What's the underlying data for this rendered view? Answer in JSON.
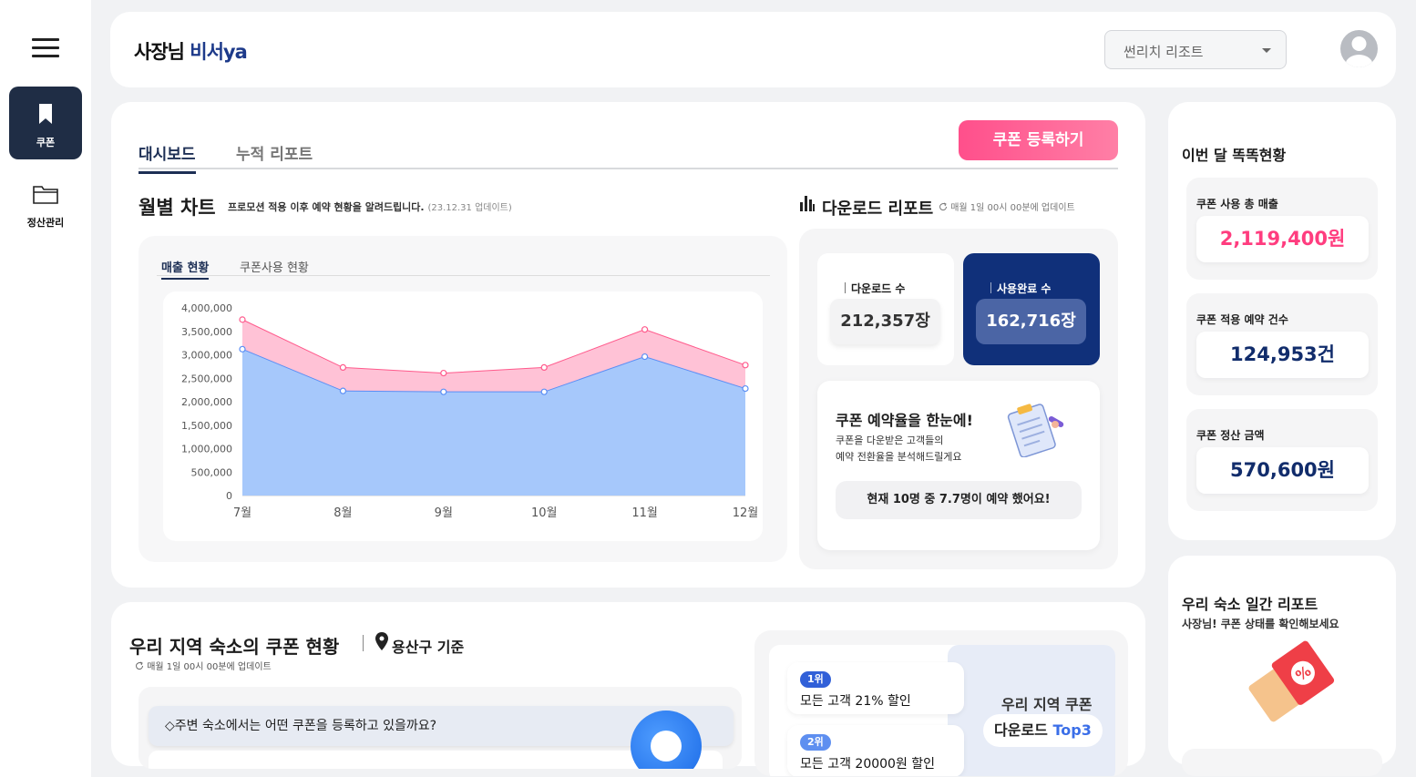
{
  "sidebar": {
    "items": [
      {
        "label": "쿠폰",
        "icon": "bookmark-icon",
        "active": true
      },
      {
        "label": "정산관리",
        "icon": "folder-icon",
        "active": false
      }
    ]
  },
  "header": {
    "logo_dark": "사장님 ",
    "logo_blue": "비서ya",
    "resort_select": "썬리치 리조트"
  },
  "dashboard": {
    "tabs": [
      {
        "label": "대시보드",
        "active": true
      },
      {
        "label": "누적 리포트",
        "active": false
      }
    ],
    "coupon_register_label": "쿠폰 등록하기",
    "monthly": {
      "title": "월별 차트",
      "desc": "프로모션 적용 이후 예약 현황을 알려드립니다.",
      "updated": "(23.12.31 업데이트)",
      "tabs": [
        {
          "label": "매출 현황",
          "active": true
        },
        {
          "label": "쿠폰사용 현황",
          "active": false
        }
      ]
    },
    "download_report": {
      "title": "다운로드 리포트",
      "updated": "매월 1일 00시 00분에 업데이트",
      "download_label": "다운로드 수",
      "download_value": "212,357장",
      "used_label": "사용완료 수",
      "used_value": "162,716장",
      "rate_title": "쿠폰 예약율을 한눈에!",
      "rate_desc_1": "쿠폰을 다운받은 고객들의",
      "rate_desc_2": "예약 전환율을 분석해드릴게요",
      "rate_pill": "현재 10명 중 7.7명이 예약 했어요!"
    }
  },
  "chart_data": {
    "type": "area",
    "categories": [
      "7월",
      "8월",
      "9월",
      "10월",
      "11월",
      "12월"
    ],
    "series": [
      {
        "values": [
          3750000,
          2730000,
          2610000,
          2730000,
          3540000,
          2780000
        ],
        "color": "#ff5a8c",
        "fill": "#ffc2d6"
      },
      {
        "values": [
          3120000,
          2230000,
          2210000,
          2210000,
          2960000,
          2280000
        ],
        "color": "#5a8ef5",
        "fill": "#a6c8fb"
      }
    ],
    "yticks": [
      "4,000,000",
      "3,500,000",
      "3,000,000",
      "2,500,000",
      "2,000,000",
      "1,500,000",
      "1,000,000",
      "500,000",
      "0"
    ],
    "ylim": [
      0,
      4000000
    ],
    "title": "",
    "xlabel": "",
    "ylabel": ""
  },
  "monthly_stats": {
    "title": "이번 달 똑똑현황",
    "items": [
      {
        "label": "쿠폰 사용 총 매출",
        "value": "2,119,400원",
        "color": "#ff3d7f"
      },
      {
        "label": "쿠폰 적용 예약 건수",
        "value": "124,953건",
        "color": "#112c6b"
      },
      {
        "label": "쿠폰 정산 금액",
        "value": "570,600원",
        "color": "#112c6b"
      }
    ]
  },
  "region": {
    "title": "우리 지역 숙소의 쿠폰 현황",
    "base": "용산구 기준",
    "updated": "매월 1일 00시 00분에 업데이트",
    "question": "주변 숙소에서는 어떤 쿠폰을 등록하고 있을까요?",
    "ranks": [
      {
        "badge": "1위",
        "text": "모든 고객 21% 할인"
      },
      {
        "badge": "2위",
        "text": "모든 고객 20000원 할인"
      }
    ],
    "top3_line1": "우리 지역 쿠폰",
    "top3_line2_prefix": "다운로드 ",
    "top3_line2_accent": "Top3"
  },
  "daily_report": {
    "title": "우리 숙소 일간 리포트",
    "subtitle": "사장님! 쿠폰 상태를 확인해보세요"
  }
}
